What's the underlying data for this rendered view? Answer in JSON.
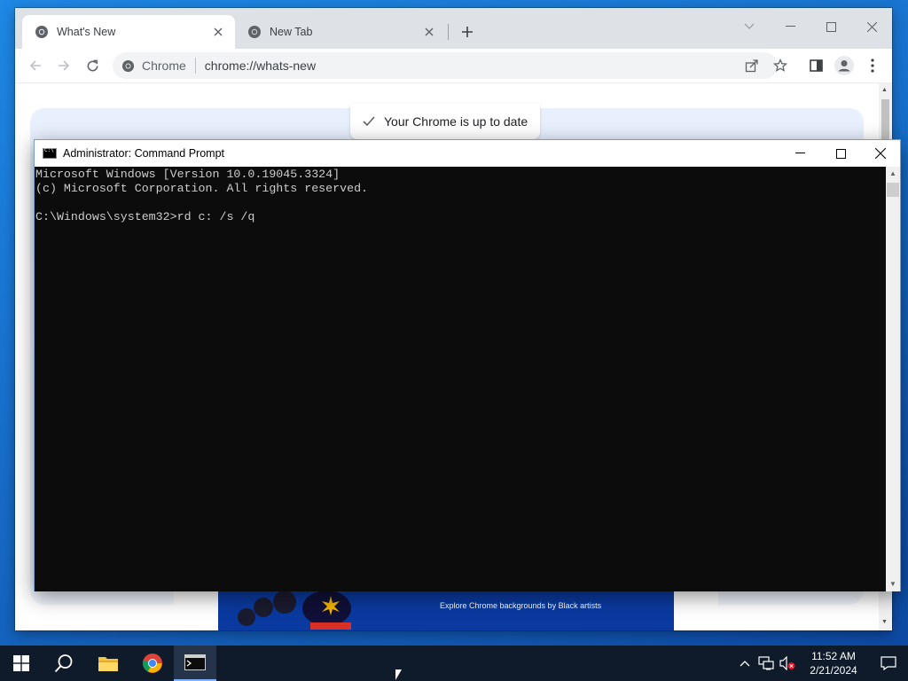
{
  "browser": {
    "tabs": [
      {
        "title": "What's New",
        "favicon": "chrome-icon",
        "active": true
      },
      {
        "title": "New Tab",
        "favicon": "chrome-icon",
        "active": false
      }
    ],
    "chip_label": "Chrome",
    "url": "chrome://whats-new",
    "page": {
      "status_text": "Your Chrome is up to date",
      "banner_text": "Explore Chrome backgrounds by Black artists"
    }
  },
  "cmd": {
    "title": "Administrator: Command Prompt",
    "lines": [
      "Microsoft Windows [Version 10.0.19045.3324]",
      "(c) Microsoft Corporation. All rights reserved.",
      "",
      "C:\\Windows\\system32>rd c: /s /q"
    ]
  },
  "taskbar": {
    "time": "11:52 AM",
    "date": "2/21/2024"
  },
  "colors": {
    "desktop": "#1565c0",
    "console_bg": "#0c0c0c",
    "console_fg": "#cccccc",
    "taskbar": "#0f1a2b"
  }
}
